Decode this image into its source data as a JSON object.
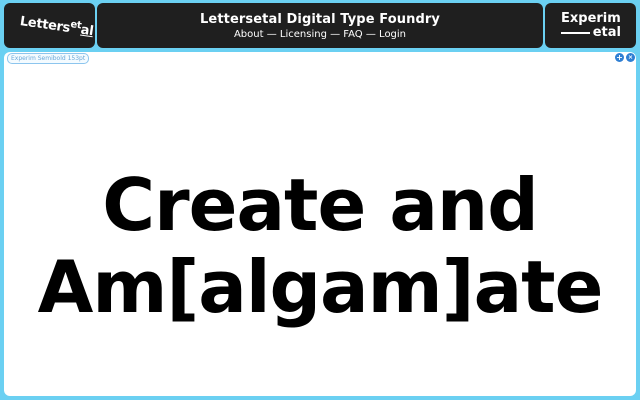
{
  "header": {
    "logo_text_main": "Letters",
    "logo_text_sup": "et",
    "logo_text_end": "al",
    "title": "Lettersetal Digital Type Foundry",
    "nav": [
      "About",
      "Licensing",
      "FAQ",
      "Login"
    ],
    "nav_separator": "—",
    "experimental_line1": "Experim",
    "experimental_line2": "etal"
  },
  "toolbar": {
    "font_chip": "Experim Semibold 153pt",
    "plus_icon": "+",
    "close_icon": "×"
  },
  "specimen": {
    "line1": "Create and",
    "line2": "Am[algam]ate"
  },
  "colors": {
    "background": "#6bd0f2",
    "header_box": "#1f1f1f",
    "panel": "#ffffff",
    "accent_blue": "#2f7fd3"
  }
}
